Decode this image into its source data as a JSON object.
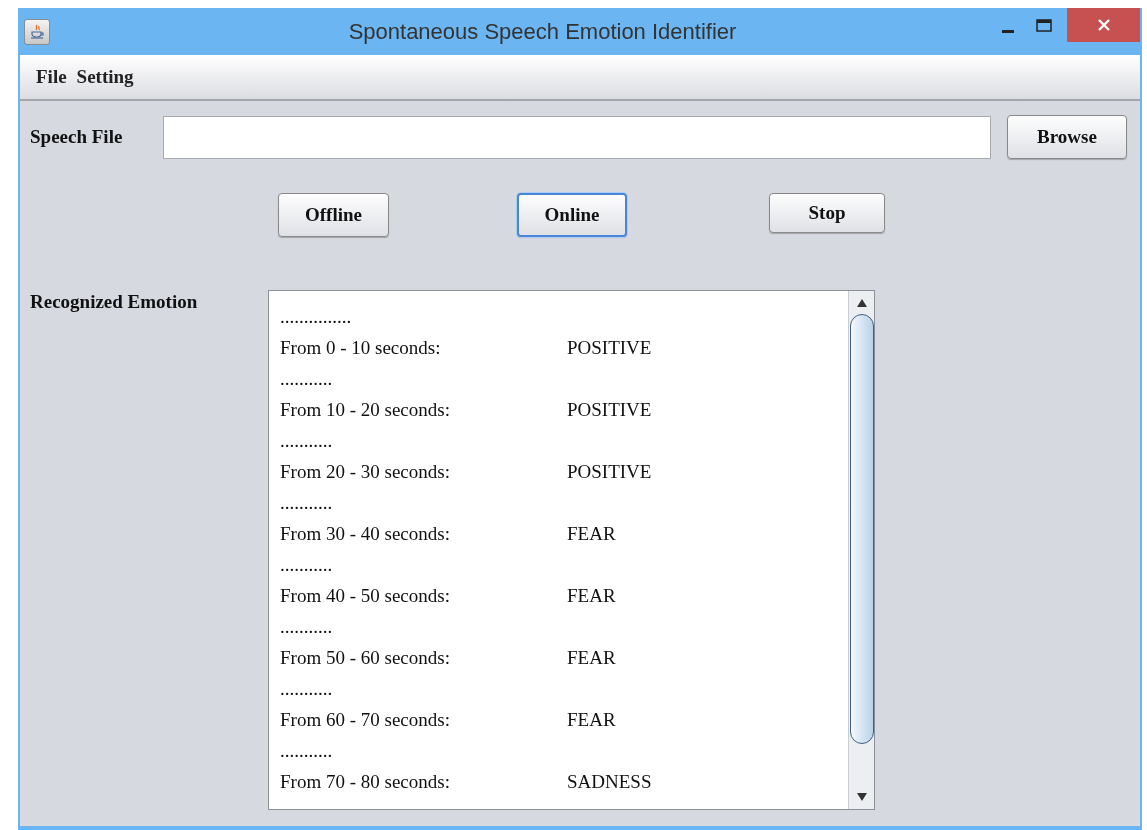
{
  "window": {
    "title": "Spontaneous Speech Emotion Identifier"
  },
  "menu": [
    "File",
    "Setting"
  ],
  "speech_file": {
    "label": "Speech File"
  },
  "browse_button": {
    "label": "Browse"
  },
  "buttons": [
    {
      "label": "Offline",
      "focused": false
    },
    {
      "label": "Online",
      "focused": true
    },
    {
      "label": "Stop",
      "focused": false
    }
  ],
  "result": {
    "label": "Recognized Emotion",
    "entries": [
      {
        "separator": "...............",
        "range": "From 0 - 10 seconds:",
        "emotion": "POSITIVE"
      },
      {
        "separator": "...........",
        "range": "From 10 - 20 seconds:",
        "emotion": "POSITIVE"
      },
      {
        "separator": "...........",
        "range": "From 20 - 30 seconds:",
        "emotion": "POSITIVE"
      },
      {
        "separator": "...........",
        "range": "From 30 - 40 seconds:",
        "emotion": "FEAR"
      },
      {
        "separator": "...........",
        "range": "From 40 - 50 seconds:",
        "emotion": "FEAR"
      },
      {
        "separator": "...........",
        "range": "From 50 - 60 seconds:",
        "emotion": "FEAR"
      },
      {
        "separator": "...........",
        "range": "From 60 - 70 seconds:",
        "emotion": "FEAR"
      },
      {
        "separator": "...........",
        "range": "From 70 - 80 seconds:",
        "emotion": "SADNESS"
      }
    ]
  }
}
